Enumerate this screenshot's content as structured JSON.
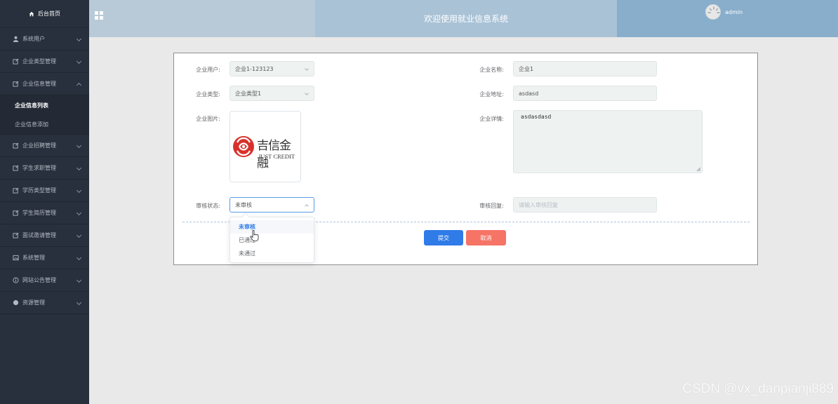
{
  "sidebar": {
    "home_label": "后台首页",
    "items": [
      {
        "label": "系统用户",
        "icon": "user-icon"
      },
      {
        "label": "企业类型管理",
        "icon": "edit-icon"
      },
      {
        "label": "企业信息管理",
        "icon": "edit-icon",
        "expanded": true,
        "children": [
          {
            "label": "企业信息列表",
            "active": true
          },
          {
            "label": "企业信息添加",
            "active": false
          }
        ]
      },
      {
        "label": "企业招聘管理",
        "icon": "edit-icon"
      },
      {
        "label": "学生求职管理",
        "icon": "edit-icon"
      },
      {
        "label": "学历类型管理",
        "icon": "edit-icon"
      },
      {
        "label": "学生简历管理",
        "icon": "edit-icon"
      },
      {
        "label": "面试邀请管理",
        "icon": "edit-icon"
      },
      {
        "label": "系统管理",
        "icon": "picture-icon"
      },
      {
        "label": "网站公告管理",
        "icon": "info-icon"
      },
      {
        "label": "资源管理",
        "icon": "data-icon"
      }
    ]
  },
  "header": {
    "title": "欢迎使用就业信息系统",
    "username": "admin"
  },
  "form": {
    "company_user_label": "企业用户:",
    "company_user_value": "企业1-123123",
    "company_name_label": "企业名称:",
    "company_name_value": "企业1",
    "company_type_label": "企业类型:",
    "company_type_value": "企业类型1",
    "company_address_label": "企业地址:",
    "company_address_value": "asdasd",
    "company_image_label": "企业图片:",
    "company_detail_label": "企业详情:",
    "company_detail_value": "asdasdasd",
    "audit_status_label": "审核状态:",
    "audit_status_value": "未审核",
    "audit_reply_label": "审核回复:",
    "audit_reply_placeholder": "请输入审核回复",
    "submit_label": "提交",
    "cancel_label": "取消"
  },
  "logo": {
    "cn_text": "吉信金融",
    "en_text": "JUST CREDIT",
    "brand_color": "#d8312b"
  },
  "dropdown": {
    "options": [
      "未审核",
      "已通过",
      "未通过"
    ],
    "selected_index": 0
  },
  "watermark": "CSDN @vx_danpianji889",
  "colors": {
    "sidebar_bg": "#28303d",
    "primary": "#2f7be8",
    "danger": "#f57466"
  }
}
